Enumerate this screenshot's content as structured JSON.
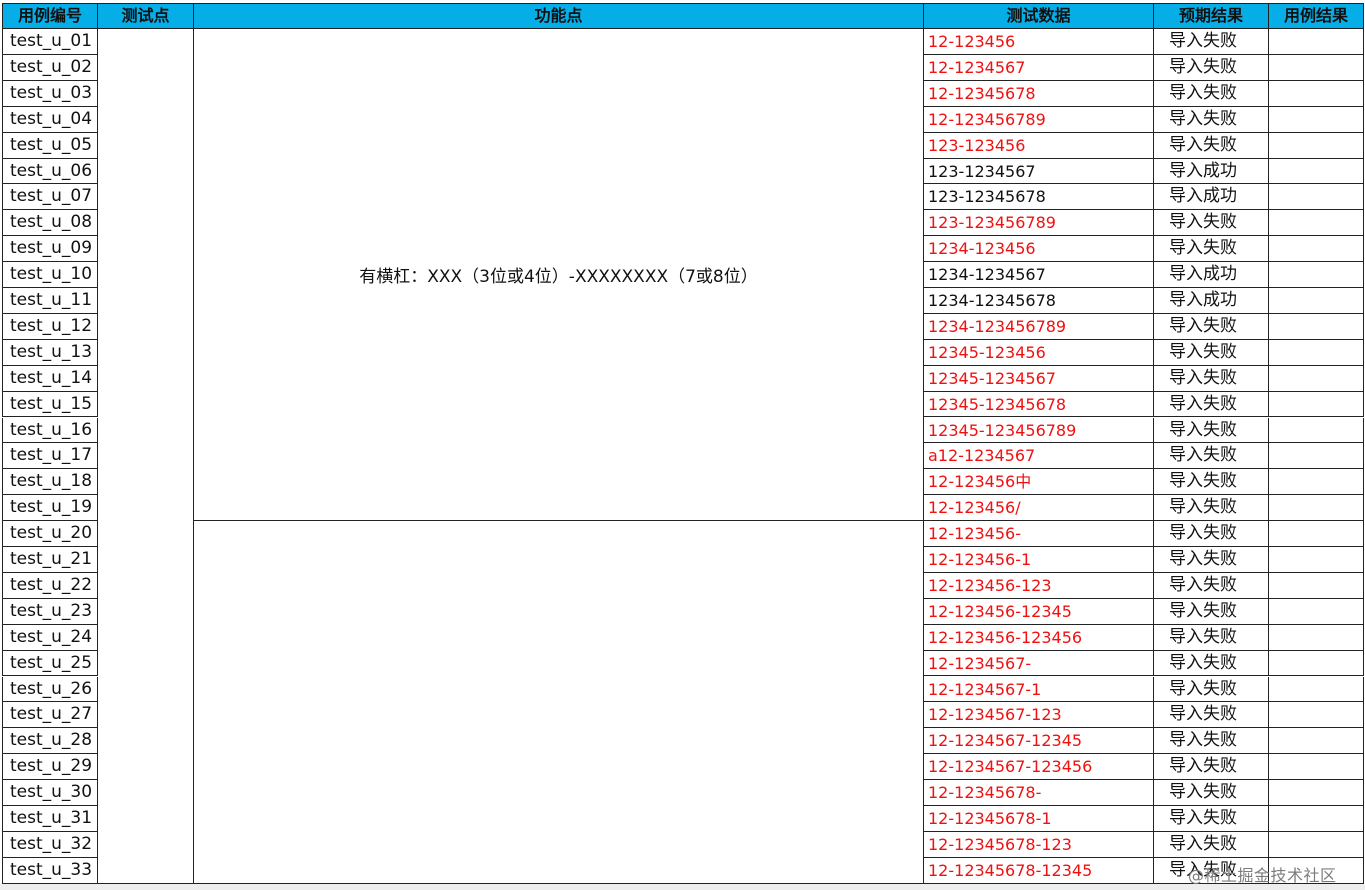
{
  "headers": {
    "case_id": "用例编号",
    "test_point": "测试点",
    "feature_point": "功能点",
    "test_data": "测试数据",
    "expected_result": "预期结果",
    "actual_result": "用例结果"
  },
  "feature_groups": [
    {
      "label": "有横杠：XXX（3位或4位）-XXXXXXXX（7或8位）",
      "rows": 19
    },
    {
      "label": "",
      "rows": 14
    }
  ],
  "colors": {
    "header_bg": "#06aee8",
    "error_text": "#f01010",
    "normal_text": "#111111"
  },
  "rows": [
    {
      "id": "test_u_01",
      "data": "12-123456",
      "expected": "导入失败",
      "highlight": true
    },
    {
      "id": "test_u_02",
      "data": "12-1234567",
      "expected": "导入失败",
      "highlight": true
    },
    {
      "id": "test_u_03",
      "data": "12-12345678",
      "expected": "导入失败",
      "highlight": true
    },
    {
      "id": "test_u_04",
      "data": "12-123456789",
      "expected": "导入失败",
      "highlight": true
    },
    {
      "id": "test_u_05",
      "data": "123-123456",
      "expected": "导入失败",
      "highlight": true
    },
    {
      "id": "test_u_06",
      "data": "123-1234567",
      "expected": "导入成功",
      "highlight": false
    },
    {
      "id": "test_u_07",
      "data": "123-12345678",
      "expected": "导入成功",
      "highlight": false
    },
    {
      "id": "test_u_08",
      "data": "123-123456789",
      "expected": "导入失败",
      "highlight": true
    },
    {
      "id": "test_u_09",
      "data": "1234-123456",
      "expected": "导入失败",
      "highlight": true
    },
    {
      "id": "test_u_10",
      "data": "1234-1234567",
      "expected": "导入成功",
      "highlight": false
    },
    {
      "id": "test_u_11",
      "data": "1234-12345678",
      "expected": "导入成功",
      "highlight": false
    },
    {
      "id": "test_u_12",
      "data": "1234-123456789",
      "expected": "导入失败",
      "highlight": true
    },
    {
      "id": "test_u_13",
      "data": "12345-123456",
      "expected": "导入失败",
      "highlight": true
    },
    {
      "id": "test_u_14",
      "data": "12345-1234567",
      "expected": "导入失败",
      "highlight": true
    },
    {
      "id": "test_u_15",
      "data": "12345-12345678",
      "expected": "导入失败",
      "highlight": true
    },
    {
      "id": "test_u_16",
      "data": "12345-123456789",
      "expected": "导入失败",
      "highlight": true
    },
    {
      "id": "test_u_17",
      "data": "a12-1234567",
      "expected": "导入失败",
      "highlight": true
    },
    {
      "id": "test_u_18",
      "data": "12-123456中",
      "expected": "导入失败",
      "highlight": true
    },
    {
      "id": "test_u_19",
      "data": "12-123456/",
      "expected": "导入失败",
      "highlight": true
    },
    {
      "id": "test_u_20",
      "data": "12-123456-",
      "expected": "导入失败",
      "highlight": true
    },
    {
      "id": "test_u_21",
      "data": "12-123456-1",
      "expected": "导入失败",
      "highlight": true
    },
    {
      "id": "test_u_22",
      "data": "12-123456-123",
      "expected": "导入失败",
      "highlight": true
    },
    {
      "id": "test_u_23",
      "data": "12-123456-12345",
      "expected": "导入失败",
      "highlight": true
    },
    {
      "id": "test_u_24",
      "data": "12-123456-123456",
      "expected": "导入失败",
      "highlight": true
    },
    {
      "id": "test_u_25",
      "data": "12-1234567-",
      "expected": "导入失败",
      "highlight": true
    },
    {
      "id": "test_u_26",
      "data": "12-1234567-1",
      "expected": "导入失败",
      "highlight": true
    },
    {
      "id": "test_u_27",
      "data": "12-1234567-123",
      "expected": "导入失败",
      "highlight": true
    },
    {
      "id": "test_u_28",
      "data": "12-1234567-12345",
      "expected": "导入失败",
      "highlight": true
    },
    {
      "id": "test_u_29",
      "data": "12-1234567-123456",
      "expected": "导入失败",
      "highlight": true
    },
    {
      "id": "test_u_30",
      "data": "12-12345678-",
      "expected": "导入失败",
      "highlight": true
    },
    {
      "id": "test_u_31",
      "data": "12-12345678-1",
      "expected": "导入失败",
      "highlight": true
    },
    {
      "id": "test_u_32",
      "data": "12-12345678-123",
      "expected": "导入失败",
      "highlight": true
    },
    {
      "id": "test_u_33",
      "data": "12-12345678-12345",
      "expected": "导入失败",
      "highlight": true
    }
  ],
  "watermark": "@稀土掘金技术社区"
}
